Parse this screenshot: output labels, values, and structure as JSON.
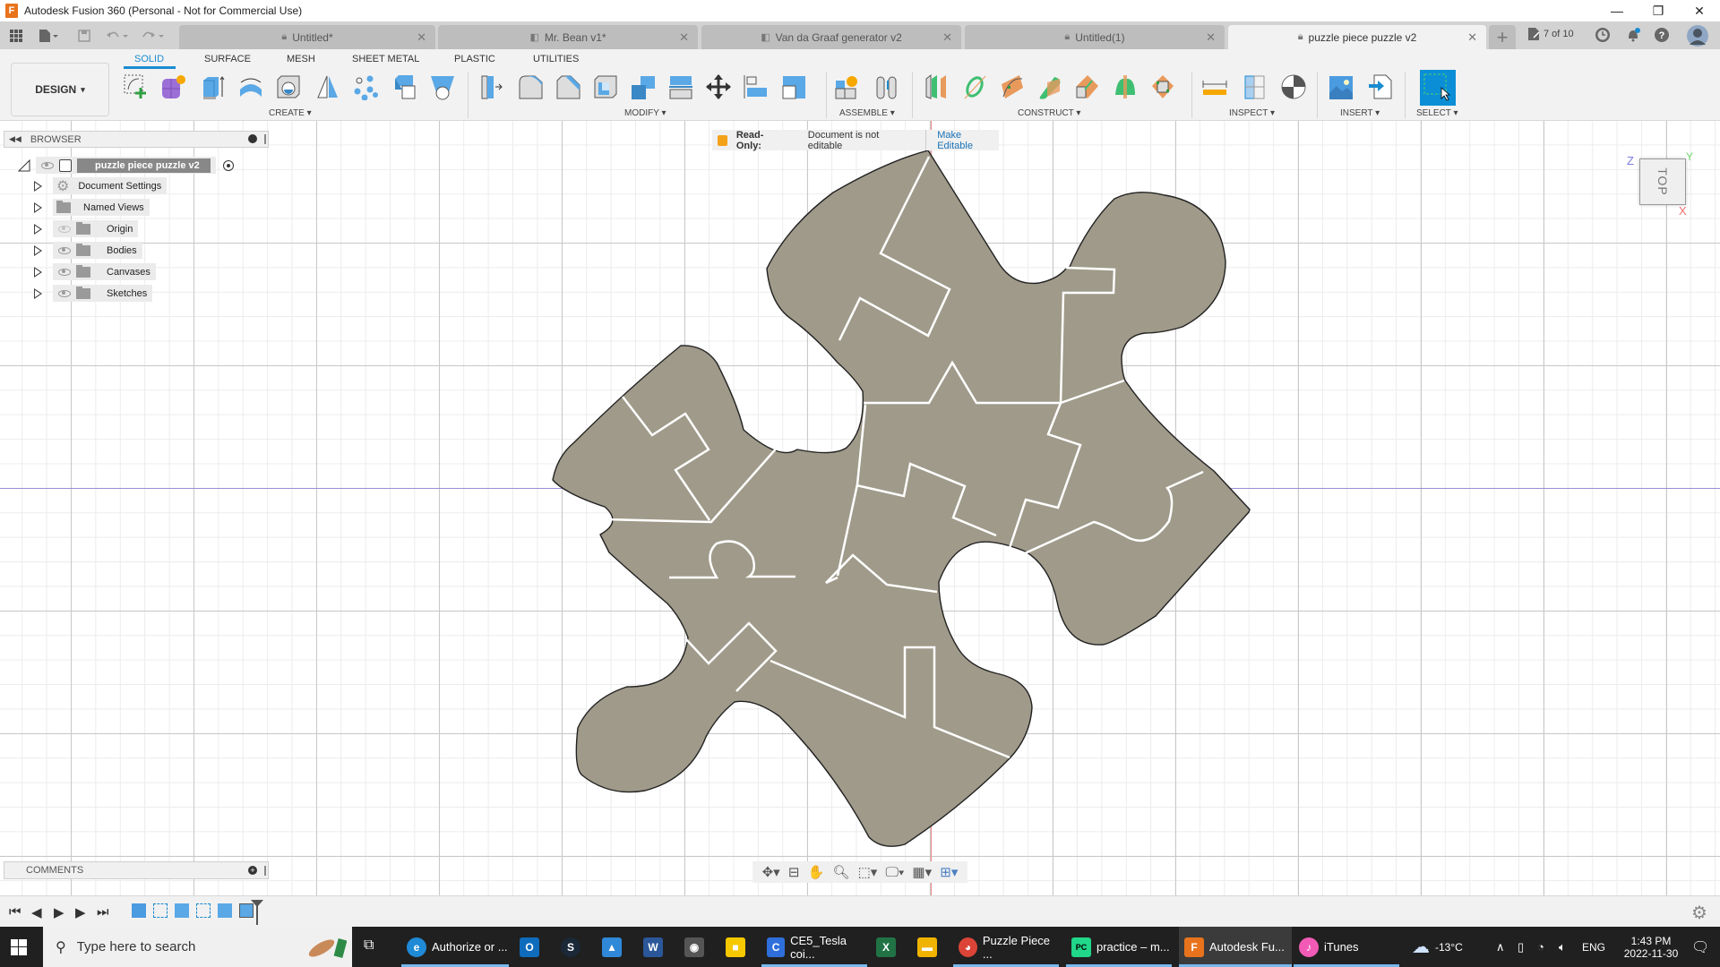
{
  "window": {
    "title": "Autodesk Fusion 360 (Personal - Not for Commercial Use)",
    "app_icon_letter": "F",
    "controls": {
      "minimize": "—",
      "restore": "❐",
      "close": "✕"
    }
  },
  "tabbar": {
    "tabs": [
      {
        "label": "Untitled*",
        "icon": "lock-icon",
        "active": false
      },
      {
        "label": "Mr. Bean v1*",
        "icon": "component-icon",
        "active": false
      },
      {
        "label": "Van da Graaf generator v2",
        "icon": "component-icon",
        "active": false
      },
      {
        "label": "Untitled(1)",
        "icon": "lock-icon",
        "active": false
      },
      {
        "label": "puzzle piece puzzle v2",
        "icon": "lock-icon",
        "active": true
      }
    ],
    "close_glyph": "✕",
    "new_tab_glyph": "+",
    "job_status": "7 of 10"
  },
  "toolbar": {
    "workspace": "DESIGN",
    "workspace_tabs": [
      "SOLID",
      "SURFACE",
      "MESH",
      "SHEET METAL",
      "PLASTIC",
      "UTILITIES"
    ],
    "active_tab": "SOLID",
    "groups": {
      "create": "CREATE",
      "modify": "MODIFY",
      "assemble": "ASSEMBLE",
      "construct": "CONSTRUCT",
      "inspect": "INSPECT",
      "insert": "INSERT",
      "select": "SELECT"
    },
    "dropdown_glyph": "▾"
  },
  "browser": {
    "title": "BROWSER",
    "root": "puzzle piece puzzle v2",
    "items": [
      {
        "label": "Document Settings",
        "icon": "gear-icon",
        "visible": null
      },
      {
        "label": "Named Views",
        "icon": "folder-icon",
        "visible": null
      },
      {
        "label": "Origin",
        "icon": "folder-icon",
        "visible": false
      },
      {
        "label": "Bodies",
        "icon": "folder-icon",
        "visible": true
      },
      {
        "label": "Canvases",
        "icon": "folder-icon",
        "visible": true
      },
      {
        "label": "Sketches",
        "icon": "folder-icon",
        "visible": true
      }
    ]
  },
  "banner": {
    "label": "Read-Only:",
    "message": "Document is not editable",
    "action": "Make Editable"
  },
  "viewcube": {
    "face": "TOP",
    "axis_x": "X",
    "axis_y": "Y",
    "axis_z": "Z"
  },
  "comments": {
    "title": "COMMENTS"
  },
  "taskbar": {
    "search_placeholder": "Type here to search",
    "apps": [
      {
        "label": "Authorize or ...",
        "color": "#1f8ad6",
        "glyph": "e"
      },
      {
        "label": "",
        "color": "#0f6cbd",
        "glyph": "O"
      },
      {
        "label": "",
        "color": "#1b2838",
        "glyph": "S"
      },
      {
        "label": "",
        "color": "#2f88d8",
        "glyph": "▲"
      },
      {
        "label": "",
        "color": "#2b579a",
        "glyph": "W"
      },
      {
        "label": "",
        "color": "#555",
        "glyph": "◉"
      },
      {
        "label": "",
        "color": "#f6c800",
        "glyph": "■"
      },
      {
        "label": "CE5_Tesla coi...",
        "color": "#2f6fdc",
        "glyph": "C"
      },
      {
        "label": "",
        "color": "#217346",
        "glyph": "X"
      },
      {
        "label": "",
        "color": "#f0b400",
        "glyph": "▬"
      },
      {
        "label": "Puzzle Piece ...",
        "color": "#db4437",
        "glyph": "◕"
      },
      {
        "label": "practice – m...",
        "color": "#21d789",
        "glyph": "PC"
      },
      {
        "label": "Autodesk Fu...",
        "color": "#e8731c",
        "glyph": "F"
      },
      {
        "label": "iTunes",
        "color": "#f15bb5",
        "glyph": "♪"
      }
    ],
    "weather": "-13°C",
    "language": "ENG",
    "time": "1:43 PM",
    "date": "2022-11-30"
  }
}
